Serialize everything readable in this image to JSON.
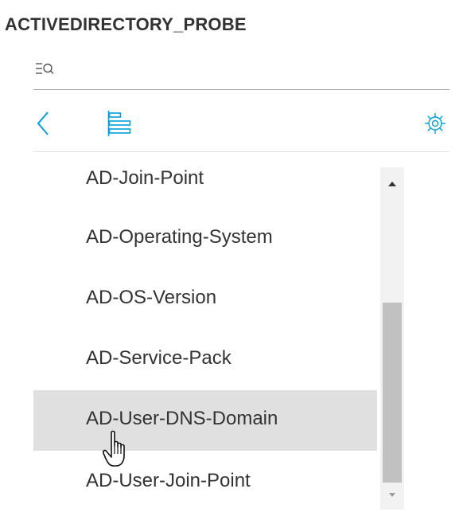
{
  "header": {
    "title": "ACTIVEDIRECTORY_PROBE"
  },
  "search": {
    "icon": "filter-search-icon"
  },
  "toolbar": {
    "back_icon": "chevron-left-icon",
    "tree_icon": "tree-view-icon",
    "settings_icon": "gear-icon",
    "accent_color": "#049fd9"
  },
  "attribute_list": {
    "items": [
      {
        "label": "AD-Join-Point"
      },
      {
        "label": "AD-Operating-System"
      },
      {
        "label": "AD-OS-Version"
      },
      {
        "label": "AD-Service-Pack"
      },
      {
        "label": "AD-User-DNS-Domain",
        "hovered": true
      },
      {
        "label": "AD-User-Join-Point"
      }
    ],
    "hover_color": "#e0e0e0"
  },
  "cursor": {
    "icon": "hand-pointer-cursor-icon"
  }
}
